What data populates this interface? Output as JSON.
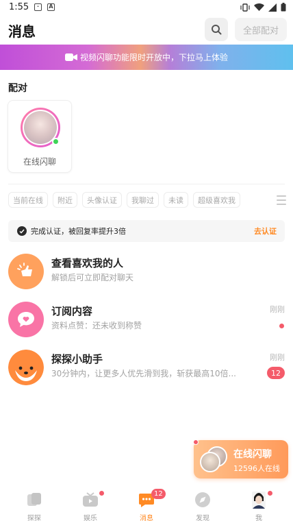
{
  "status_bar": {
    "time": "1:55",
    "icon_b": "A"
  },
  "header": {
    "title": "消息",
    "all_match_label": "全部配对"
  },
  "banner": {
    "text": "视频闪聊功能限时开放中，下拉马上体验"
  },
  "match_section": {
    "title": "配对",
    "card": {
      "label": "在线闪聊"
    }
  },
  "filters": [
    "当前在线",
    "附近",
    "头像认证",
    "我聊过",
    "未读",
    "超级喜欢我"
  ],
  "verify": {
    "text": "完成认证，被回复率提升3倍",
    "link": "去认证"
  },
  "conversations": [
    {
      "name": "查看喜欢我的人",
      "preview": "解锁后可立即配对聊天",
      "time": "",
      "badge": "",
      "dot": false,
      "color": "#ffa15d",
      "icon": "like-hand-icon"
    },
    {
      "name": "订阅内容",
      "preview": "资料点赞：还未收到称赞",
      "time": "刚刚",
      "badge": "",
      "dot": true,
      "color": "#f974a6",
      "icon": "heart-bubble-icon"
    },
    {
      "name": "探探小助手",
      "preview": "30分钟内，让更多人优先滑到我，斩获最高10倍...",
      "time": "刚刚",
      "badge": "12",
      "dot": false,
      "color": "#ff8b3d",
      "icon": "fox-icon"
    }
  ],
  "float_card": {
    "title": "在线闪聊",
    "subtitle": "12596人在线"
  },
  "tabbar": {
    "tabs": [
      {
        "label": "探探"
      },
      {
        "label": "娱乐"
      },
      {
        "label": "消息",
        "badge": "12"
      },
      {
        "label": "发现"
      },
      {
        "label": "我"
      }
    ]
  },
  "colors": {
    "accent": "#ff8a24",
    "badge": "#f45b6a",
    "online": "#3fd458"
  }
}
